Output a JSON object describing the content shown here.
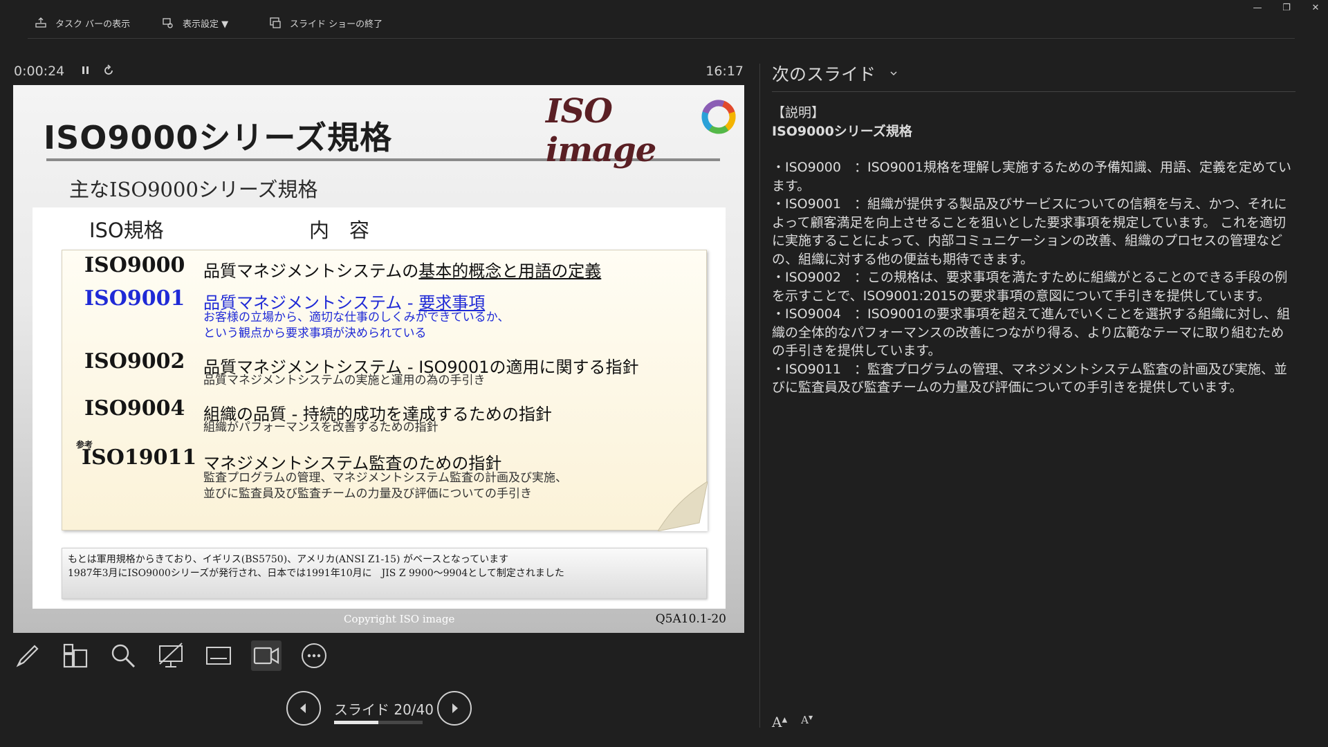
{
  "toolbar": {
    "taskbar_label": "タスク バーの表示",
    "display_settings_label": "表示設定 ▼",
    "end_show_label": "スライド ショーの終了"
  },
  "window": {
    "minimize": "—",
    "restore": "❐",
    "close": "✕"
  },
  "presenter": {
    "elapsed_time": "0:00:24",
    "clock": "16:17",
    "slide_counter": "スライド 20/40",
    "progress_fraction": 0.5
  },
  "slide": {
    "title": "ISO9000シリーズ規格",
    "logo_text": "ISO image",
    "subtitle": "主なISO9000シリーズ規格",
    "col_standard": "ISO規格",
    "col_content": "内　容",
    "rows": [
      {
        "code": "ISO9000",
        "main_pre": "品質マネジメントシステムの",
        "main_link": "基本的概念と用語の定義"
      },
      {
        "code": "ISO9001",
        "main_pre": "品質マネジメントシステム - ",
        "main_link": "要求事項",
        "sub1": "お客様の立場から、適切な仕事のしくみができているか、",
        "sub2": "という観点から要求事項が決められている"
      },
      {
        "code": "ISO9002",
        "main": "品質マネジメントシステム - ISO9001の適用に関する指針",
        "sub1": "品質マネジメントシステムの実施と運用の為の手引き"
      },
      {
        "code": "ISO9004",
        "main": "組織の品質 - 持続的成功を達成するための指針",
        "sub1": "組織がパフォーマンスを改善するための指針"
      },
      {
        "ref": "参考",
        "code": "ISO19011",
        "main": "マネジメントシステム監査のための指針",
        "sub1": "監査プログラムの管理、マネジメントシステム監査の計画及び実施、",
        "sub2": "並びに監査員及び監査チームの力量及び評価についての手引き"
      }
    ],
    "note_line1": "もとは軍用規格からきており、イギリス(BS5750)、アメリカ(ANSI Z1-15) がベースとなっています",
    "note_line2": "1987年3月にISO9000シリーズが発行され、日本では1991年10月に　JIS Z 9900～9904として制定されました",
    "copyright": "Copyright ISO image",
    "slide_id": "Q5A10.1-20"
  },
  "next_slide": {
    "label": "次のスライド"
  },
  "notes": {
    "header": "【説明】",
    "title": "ISO9000シリーズ規格",
    "items": [
      "・ISO9000　：ISO9001規格を理解し実施するための予備知識、用語、定義を定めています。",
      "・ISO9001　：組織が提供する製品及びサービスについての信頼を与え、かつ、それによって顧客満足を向上させることを狙いとした要求事項を規定しています。 これを適切に実施することによって、内部コミュニケーションの改善、組織のプロセスの管理などの、組織に対する他の便益も期待できます。",
      "・ISO9002　：この規格は、要求事項を満たすために組織がとることのできる手段の例を示すことで、ISO9001:2015の要求事項の意図について手引きを提供しています。",
      "・ISO9004　：ISO9001の要求事項を超えて進んでいくことを選択する組織に対し、組織の全体的なパフォーマンスの改善につながり得る、より広範なテーマに取り組むための手引きを提供しています。",
      "・ISO9011　：監査プログラムの管理、マネジメントシステム監査の計画及び実施、並びに監査員及び監査チームの力量及び評価についての手引きを提供しています。"
    ]
  },
  "font_controls": {
    "increase": "A",
    "decrease": "A"
  },
  "colors": {
    "background": "#1f1f1f",
    "link_blue": "#1f2ad6",
    "slide_title": "#1d1d1d"
  }
}
